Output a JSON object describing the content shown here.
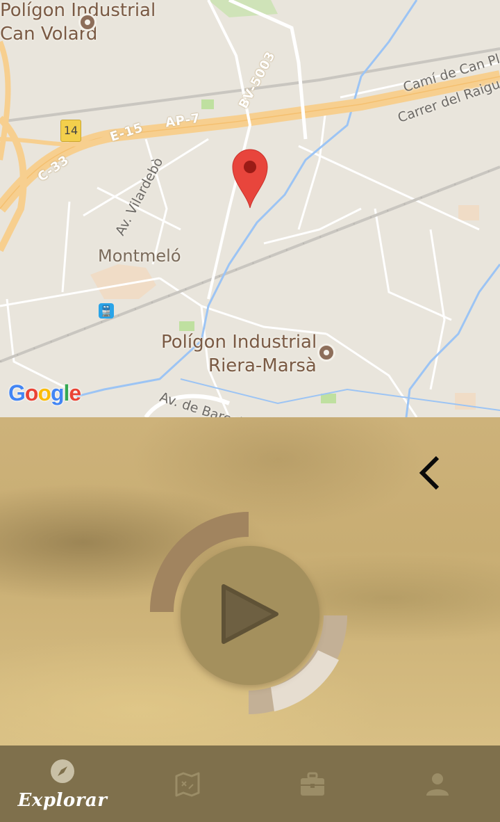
{
  "map": {
    "poi_1": {
      "line1": "Polígon Industrial",
      "line2": "Can Volard"
    },
    "poi_2": {
      "line1": "Polígon Industrial",
      "line2": "Riera-Marsà"
    },
    "town": "Montmeló",
    "roads": {
      "bv": "BV-5003",
      "e15": "E-15",
      "ap7": "AP-7",
      "c33": "C-33",
      "shield": "14"
    },
    "streets": {
      "vilardebo": "Av. Vilardebò",
      "barcelona": "Av. de Barcelona",
      "can_pla": "Camí de Can Pla",
      "raiguer": "Carrer del Raiguer"
    },
    "google": [
      "G",
      "o",
      "o",
      "g",
      "l",
      "e"
    ],
    "marker_color": "#e8453c"
  },
  "player": {
    "back_icon": "chevron-left-icon",
    "play_icon": "play-icon",
    "progress_fraction": 0.25
  },
  "tabbar": {
    "tabs": [
      {
        "icon": "compass-icon",
        "label": "Explorar",
        "active": true
      },
      {
        "icon": "map-icon",
        "label": "",
        "active": false
      },
      {
        "icon": "briefcase-icon",
        "label": "",
        "active": false
      },
      {
        "icon": "user-icon",
        "label": "",
        "active": false
      }
    ]
  },
  "colors": {
    "tabbar_bg": "#7f704c",
    "active_tab_icon": "#c9c0a6",
    "inactive_tab_icon": "#9b8d67",
    "ring_dark": "#a1845f",
    "ring_light": "#c3b096",
    "ring_lightest": "#e6ddd0"
  }
}
